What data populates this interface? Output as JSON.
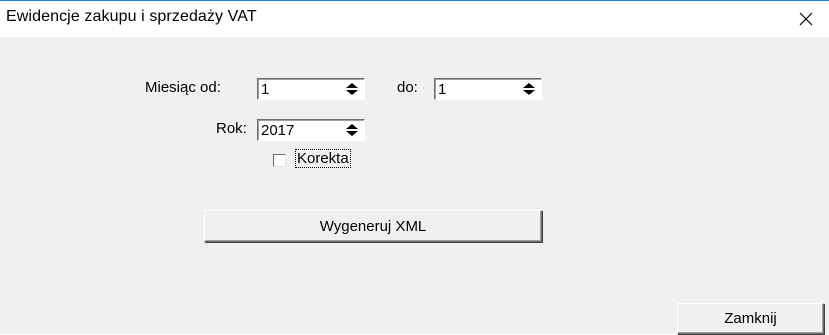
{
  "window": {
    "title": "Ewidencje zakupu i sprzedaży VAT"
  },
  "form": {
    "month_from_label": "Miesiąc od:",
    "month_from_value": "1",
    "month_to_label": "do:",
    "month_to_value": "1",
    "year_label": "Rok:",
    "year_value": "2017",
    "correction_label": "Korekta",
    "correction_checked": false,
    "generate_button": "Wygeneruj XML",
    "close_button": "Zamknij"
  }
}
